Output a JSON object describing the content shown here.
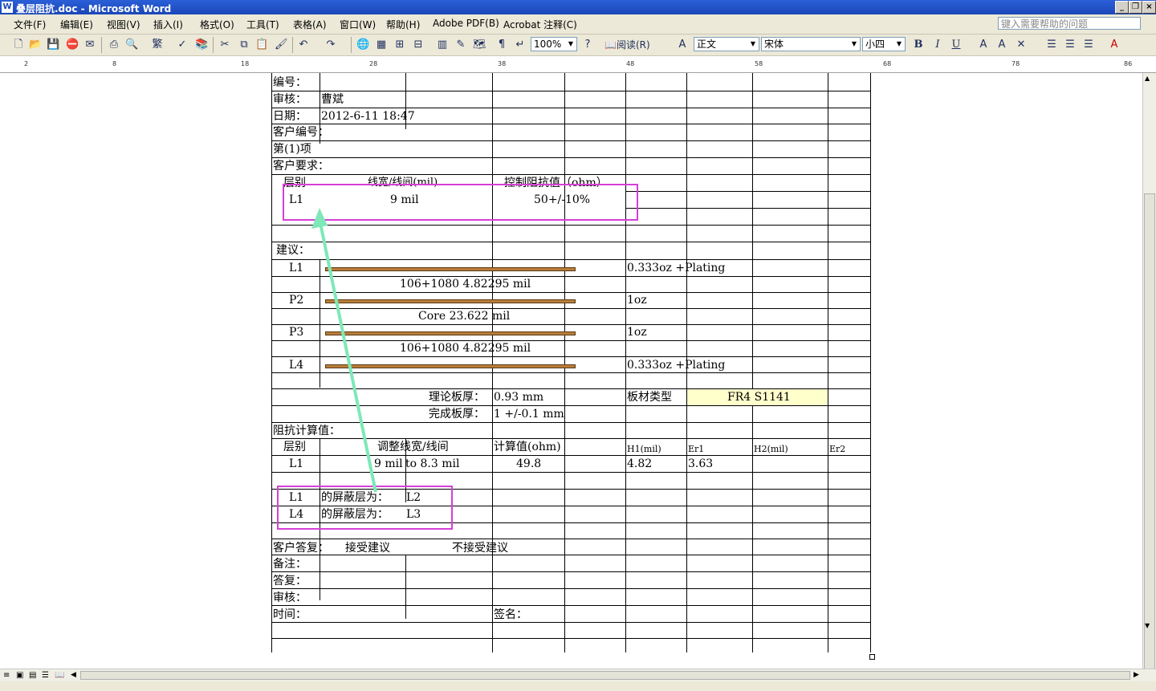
{
  "window": {
    "title": "叠层阻抗.doc - Microsoft Word",
    "icon": "word-doc-icon"
  },
  "menu": [
    "文件(F)",
    "编辑(E)",
    "视图(V)",
    "插入(I)",
    "格式(O)",
    "工具(T)",
    "表格(A)",
    "窗口(W)",
    "帮助(H)",
    "Adobe PDF(B)",
    "Acrobat 注释(C)"
  ],
  "help_placeholder": "键入需要帮助的问题",
  "toolbar": {
    "zoom": "100%",
    "read_label": "阅读(R)",
    "style": "正文",
    "font": "宋体",
    "size": "小四",
    "bold": "B",
    "italic": "I",
    "underline": "U"
  },
  "doc": {
    "r1": "编号：",
    "r2a": "审核：",
    "r2b": "曹斌",
    "r3a": "日期：",
    "r3b": "2012-6-11 18:47",
    "r4": "客户编号：",
    "r5": "第(1)项",
    "r6": "客户要求：",
    "req_h1": "层别",
    "req_h2": "线宽/线间(mil)",
    "req_h3": "控制阻抗值（ohm）",
    "req_l1": "L1",
    "req_w": "9 mil",
    "req_z": "50+/-10%",
    "advice": "建议：",
    "s_l1": "L1",
    "s_l1_cu": "0.333oz +Plating",
    "s_pp1": "106+1080     4.82295 mil",
    "s_p2": "P2",
    "s_p2_cu": "1oz",
    "s_core": "Core    23.622 mil",
    "s_p3": "P3",
    "s_p3_cu": "1oz",
    "s_pp2": "106+1080     4.82295 mil",
    "s_l4": "L4",
    "s_l4_cu": "0.333oz +Plating",
    "th_label": "理论板厚：",
    "th_val": "0.93 mm",
    "mat_label": "板材类型",
    "mat_val": "FR4  S1141",
    "fin_label": "完成板厚：",
    "fin_val": "1 +/-0.1 mm",
    "calc": "阻抗计算值：",
    "c_h1": "层别",
    "c_h2": "调整线宽/线间",
    "c_h3": "计算值(ohm)",
    "c_h4": "H1(mil)",
    "c_h5": "Er1",
    "c_h6": "H2(mil)",
    "c_h7": "Er2",
    "c_l1": "L1",
    "c_w1": "9 mil",
    "c_w2": "to  8.3 mil",
    "c_z": "49.8",
    "c_h1v": "4.82",
    "c_er1": "3.63",
    "sh1a": "L1",
    "sh1b": "的屏蔽层为：",
    "sh1c": "L2",
    "sh2a": "L4",
    "sh2b": "的屏蔽层为：",
    "sh2c": "L3",
    "reply": "客户答复：",
    "accept": "接受建议",
    "reject": "不接受建议",
    "note": "备注：",
    "answer": "答复：",
    "rev": "审核：",
    "time": "时间：",
    "sign": "签名："
  },
  "colors": {
    "title_bar": "#1b47b8",
    "annotation": "#d63fd6",
    "arrow": "#7fe8b8",
    "layer_bar": "#b97d3a",
    "highlight": "#ffffcc"
  }
}
